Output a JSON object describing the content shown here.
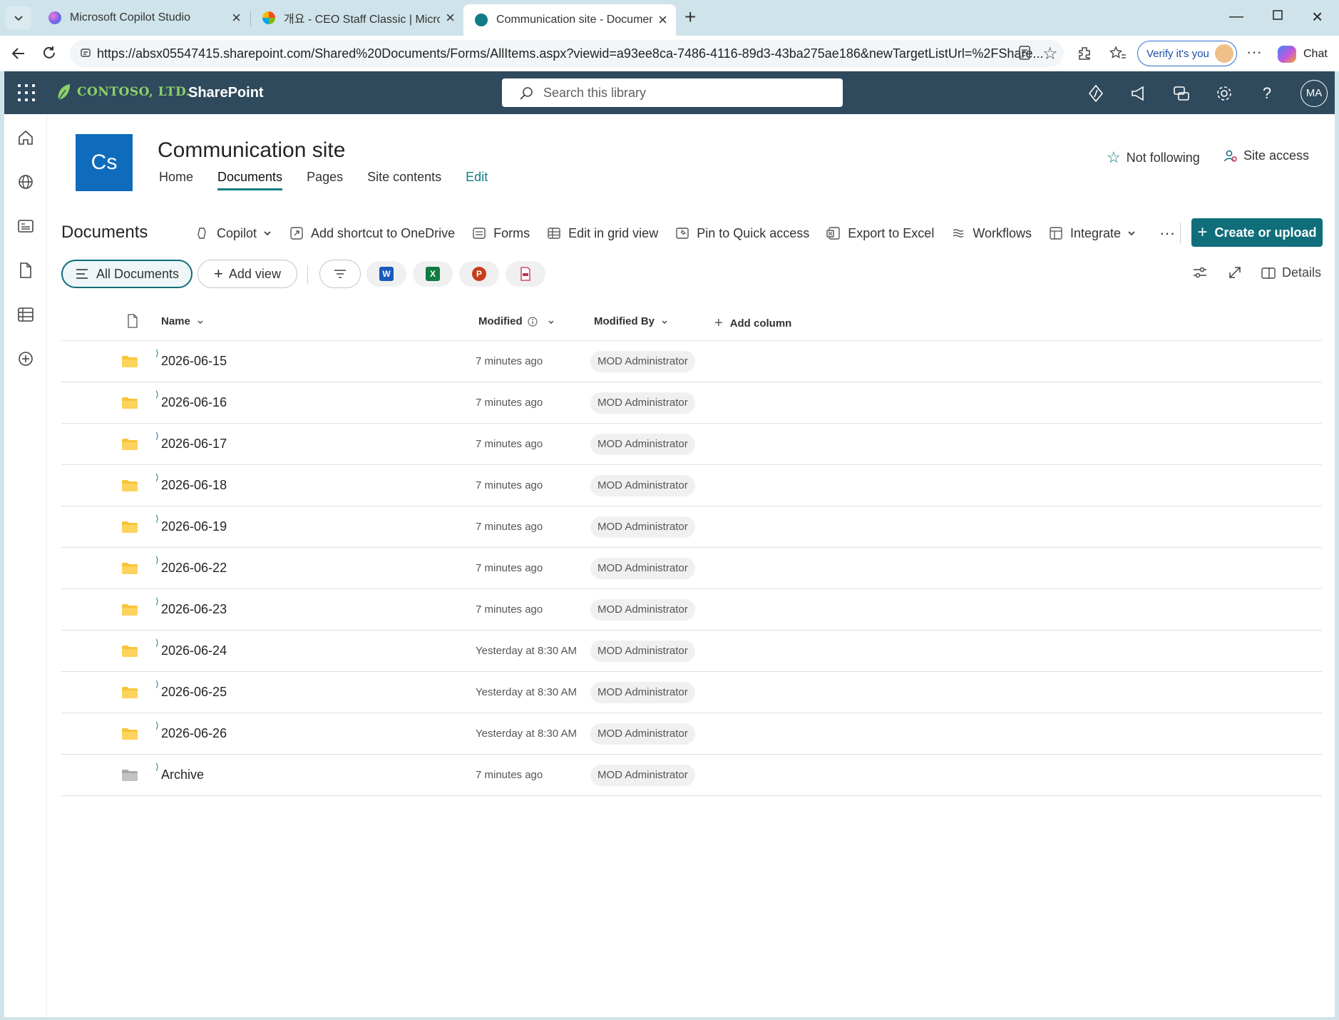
{
  "browser": {
    "tabs": [
      {
        "title": "Microsoft Copilot Studio",
        "active": false
      },
      {
        "title": "개요 - CEO Staff Classic | Microsoft",
        "active": false
      },
      {
        "title": "Communication site - Documents",
        "active": true
      }
    ],
    "url": "https://absx05547415.sharepoint.com/Shared%20Documents/Forms/AllItems.aspx?viewid=a93ee8ca-7486-4116-89d3-43ba275ae186&newTargetListUrl=%2FShare...",
    "verify_label": "Verify it's you",
    "chat_label": "Chat"
  },
  "suite": {
    "org_name": "CONTOSO, LTD.",
    "app_name": "SharePoint",
    "search_placeholder": "Search this library",
    "user_initials": "MA",
    "brand_color": "#2f4a5c"
  },
  "site": {
    "logo_text": "Cs",
    "title": "Communication site",
    "nav": [
      {
        "label": "Home",
        "active": false
      },
      {
        "label": "Documents",
        "active": true
      },
      {
        "label": "Pages",
        "active": false
      },
      {
        "label": "Site contents",
        "active": false
      },
      {
        "label": "Edit",
        "active": false
      }
    ],
    "follow_label": "Not following",
    "access_label": "Site access"
  },
  "library": {
    "title": "Documents",
    "commands": [
      {
        "label": "Copilot",
        "icon": "copilot-icon"
      },
      {
        "label": "Add shortcut to OneDrive",
        "icon": "shortcut-icon"
      },
      {
        "label": "Forms",
        "icon": "forms-icon"
      },
      {
        "label": "Edit in grid view",
        "icon": "grid-icon"
      },
      {
        "label": "Pin to Quick access",
        "icon": "pin-icon"
      },
      {
        "label": "Export to Excel",
        "icon": "excel-export-icon"
      },
      {
        "label": "Workflows",
        "icon": "workflows-icon"
      },
      {
        "label": "Integrate",
        "icon": "integrate-icon"
      }
    ],
    "create_label": "Create or upload",
    "view_label": "All Documents",
    "add_view_label": "Add view",
    "details_label": "Details",
    "columns": {
      "name": "Name",
      "modified": "Modified",
      "modified_by": "Modified By",
      "add_column": "Add column"
    },
    "items": [
      {
        "name": "2026-06-15",
        "modified": "7 minutes ago",
        "modified_by": "MOD Administrator",
        "color": "yellow"
      },
      {
        "name": "2026-06-16",
        "modified": "7 minutes ago",
        "modified_by": "MOD Administrator",
        "color": "yellow"
      },
      {
        "name": "2026-06-17",
        "modified": "7 minutes ago",
        "modified_by": "MOD Administrator",
        "color": "yellow"
      },
      {
        "name": "2026-06-18",
        "modified": "7 minutes ago",
        "modified_by": "MOD Administrator",
        "color": "yellow"
      },
      {
        "name": "2026-06-19",
        "modified": "7 minutes ago",
        "modified_by": "MOD Administrator",
        "color": "yellow"
      },
      {
        "name": "2026-06-22",
        "modified": "7 minutes ago",
        "modified_by": "MOD Administrator",
        "color": "yellow"
      },
      {
        "name": "2026-06-23",
        "modified": "7 minutes ago",
        "modified_by": "MOD Administrator",
        "color": "yellow"
      },
      {
        "name": "2026-06-24",
        "modified": "Yesterday at 8:30 AM",
        "modified_by": "MOD Administrator",
        "color": "yellow"
      },
      {
        "name": "2026-06-25",
        "modified": "Yesterday at 8:30 AM",
        "modified_by": "MOD Administrator",
        "color": "yellow"
      },
      {
        "name": "2026-06-26",
        "modified": "Yesterday at 8:30 AM",
        "modified_by": "MOD Administrator",
        "color": "yellow"
      },
      {
        "name": "Archive",
        "modified": "7 minutes ago",
        "modified_by": "MOD Administrator",
        "color": "gray"
      }
    ]
  }
}
